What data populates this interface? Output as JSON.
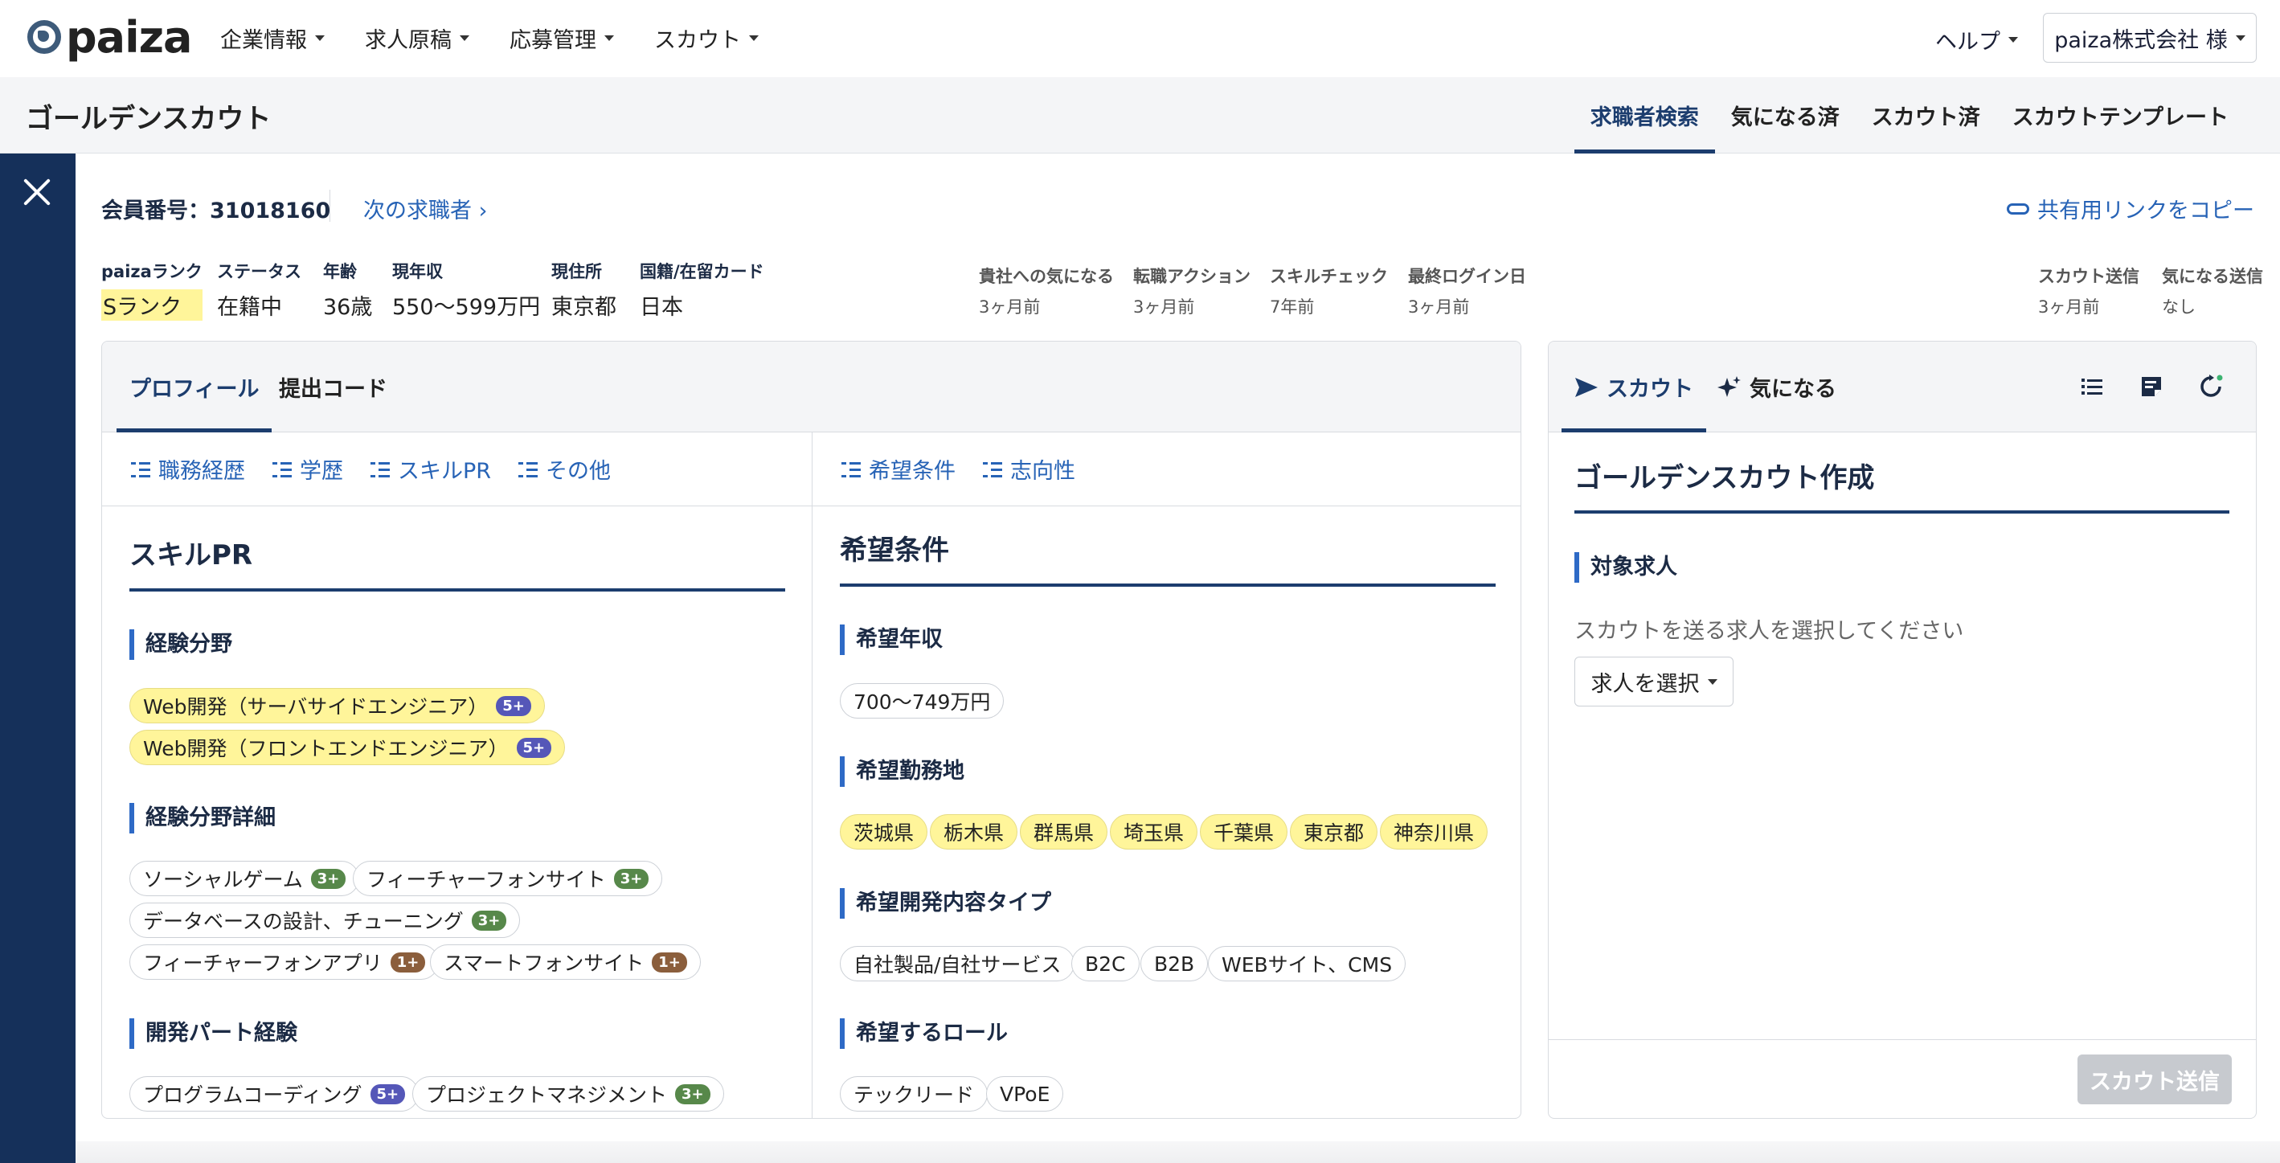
{
  "nav": {
    "logo": "paiza",
    "menu": [
      "企業情報",
      "求人原稿",
      "応募管理",
      "スカウト"
    ],
    "help": "ヘルプ",
    "account": "paiza株式会社 様"
  },
  "subheader": {
    "title": "ゴールデンスカウト",
    "tabs": [
      "求職者検索",
      "気になる済",
      "スカウト済",
      "スカウトテンプレート"
    ]
  },
  "member": {
    "number": "会員番号：31018160",
    "next": "次の求職者 ›",
    "copy_link": "共有用リンクをコピー"
  },
  "info": [
    {
      "label": "paizaランク",
      "value": "Sランク"
    },
    {
      "label": "ステータス",
      "value": "在籍中"
    },
    {
      "label": "年齢",
      "value": "36歳"
    },
    {
      "label": "現年収",
      "value": "550〜599万円"
    },
    {
      "label": "現住所",
      "value": "東京都"
    },
    {
      "label": "国籍/在留カード",
      "value": "日本"
    }
  ],
  "activity": [
    {
      "label": "貴社への気になる",
      "value": "3ヶ月前"
    },
    {
      "label": "転職アクション",
      "value": "3ヶ月前"
    },
    {
      "label": "スキルチェック",
      "value": "7年前"
    },
    {
      "label": "最終ログイン日",
      "value": "3ヶ月前"
    }
  ],
  "scout_status": [
    {
      "label": "スカウト送信",
      "value": "3ヶ月前"
    },
    {
      "label": "気になる送信",
      "value": "なし"
    }
  ],
  "left_panel": {
    "tabs": [
      "プロフィール",
      "提出コード"
    ],
    "anchors_left": [
      "職務経歴",
      "学歴",
      "スキルPR",
      "その他"
    ],
    "anchors_right": [
      "希望条件",
      "志向性"
    ],
    "skill": {
      "title": "スキルPR",
      "field_title": "経験分野",
      "fields": [
        {
          "label": "Web開発（サーバサイドエンジニア）",
          "badge": "5+"
        },
        {
          "label": "Web開発（フロントエンドエンジニア）",
          "badge": "5+"
        }
      ],
      "detail_title": "経験分野詳細",
      "details": [
        {
          "label": "ソーシャルゲーム",
          "badge": "3+"
        },
        {
          "label": "フィーチャーフォンサイト",
          "badge": "3+"
        },
        {
          "label": "データベースの設計、チューニング",
          "badge": "3+"
        },
        {
          "label": "フィーチャーフォンアプリ",
          "badge": "1+"
        },
        {
          "label": "スマートフォンサイト",
          "badge": "1+"
        }
      ],
      "part_title": "開発パート経験",
      "parts": [
        {
          "label": "プログラムコーディング",
          "badge": "5+"
        },
        {
          "label": "プロジェクトマネジメント",
          "badge": "3+"
        }
      ]
    },
    "wish": {
      "title": "希望条件",
      "salary_title": "希望年収",
      "salary": "700〜749万円",
      "location_title": "希望勤務地",
      "locations": [
        "茨城県",
        "栃木県",
        "群馬県",
        "埼玉県",
        "千葉県",
        "東京都",
        "神奈川県"
      ],
      "type_title": "希望開発内容タイプ",
      "types": [
        "自社製品/自社サービス",
        "B2C",
        "B2B",
        "WEBサイト、CMS"
      ],
      "role_title": "希望するロール",
      "roles": [
        "テックリード",
        "VPoE"
      ]
    }
  },
  "right_panel": {
    "tabs": [
      "スカウト",
      "気になる"
    ],
    "title": "ゴールデンスカウト作成",
    "target_title": "対象求人",
    "hint": "スカウトを送る求人を選択してください",
    "select": "求人を選択",
    "send": "スカウト送信"
  },
  "colors": {
    "navy": "#15305a",
    "link": "#2763b6",
    "highlight": "#fff59a",
    "badge_5": "#5557b8",
    "badge_3": "#57884a",
    "badge_1": "#8b5e3c"
  }
}
